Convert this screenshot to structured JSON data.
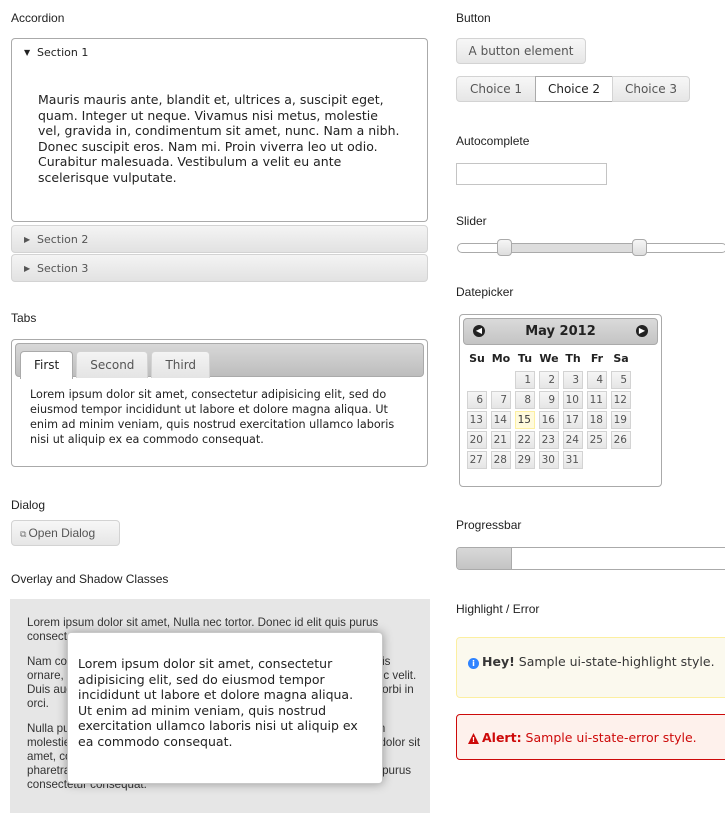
{
  "accordion": {
    "heading": "Accordion",
    "sections": [
      {
        "label": "Section 1",
        "expanded": true
      },
      {
        "label": "Section 2",
        "expanded": false
      },
      {
        "label": "Section 3",
        "expanded": false
      }
    ],
    "content": "Mauris mauris ante, blandit et, ultrices a, suscipit eget, quam. Integer ut neque. Vivamus nisi metus, molestie vel, gravida in, condimentum sit amet, nunc. Nam a nibh. Donec suscipit eros. Nam mi. Proin viverra leo ut odio. Curabitur malesuada. Vestibulum a velit eu ante scelerisque vulputate."
  },
  "tabs": {
    "heading": "Tabs",
    "items": [
      "First",
      "Second",
      "Third"
    ],
    "active_index": 0,
    "content": "Lorem ipsum dolor sit amet, consectetur adipisicing elit, sed do eiusmod tempor incididunt ut labore et dolore magna aliqua. Ut enim ad minim veniam, quis nostrud exercitation ullamco laboris nisi ut aliquip ex ea commodo consequat."
  },
  "dialog": {
    "heading": "Dialog",
    "button_label": "Open Dialog",
    "icon": "newwin-icon"
  },
  "overlay": {
    "heading": "Overlay and Shadow Classes",
    "background_text": [
      "Lorem ipsum dolor sit amet, Nulla nec tortor. Donec id elit quis purus consectetur consequat.",
      "Nam congue semper tellus. Sed erat dolor, dapibus sit amet, venenatis ornare, ultrices ut, nisi. Aliquam ante. Suspendisse scelerisque dui nec velit. Duis augue augue, gravida euismod, vulputate ac, facilisis id, sem. Morbi in orci.",
      "Nulla purus lacus, pulvinar vel, malesuada ac, mattis nec, quam. Nam molestie scelerisque quam. Nullam feugiat cursus lacus.orem ipsum dolor sit amet, consectetur adipiscing elit. Donec libero risus, commodo vitae, pharetra mollis, posuere eu, pede. Nulla nec tortor. Donec id elit quis purus consectetur consequat."
    ],
    "shadow_text": "Lorem ipsum dolor sit amet, consectetur adipisicing elit, sed do eiusmod tempor incididunt ut labore et dolore magna aliqua. Ut enim ad minim veniam, quis nostrud exercitation ullamco laboris nisi ut aliquip ex ea commodo consequat."
  },
  "button": {
    "heading": "Button",
    "single_label": "A button element",
    "choices": [
      "Choice 1",
      "Choice 2",
      "Choice 3"
    ],
    "selected_index": 1
  },
  "autocomplete": {
    "heading": "Autocomplete",
    "value": ""
  },
  "slider": {
    "heading": "Slider",
    "range_start": 17,
    "range_end": 67
  },
  "datepicker": {
    "heading": "Datepicker",
    "title": "May 2012",
    "prev_icon": "circle-triangle-w-icon",
    "next_icon": "circle-triangle-e-icon",
    "weekdays": [
      "Su",
      "Mo",
      "Tu",
      "We",
      "Th",
      "Fr",
      "Sa"
    ],
    "first_weekday_index": 2,
    "days": [
      1,
      2,
      3,
      4,
      5,
      6,
      7,
      8,
      9,
      10,
      11,
      12,
      13,
      14,
      15,
      16,
      17,
      18,
      19,
      20,
      21,
      22,
      23,
      24,
      25,
      26,
      27,
      28,
      29,
      30,
      31
    ],
    "today": 15
  },
  "progressbar": {
    "heading": "Progressbar",
    "value_percent": 20
  },
  "highlight": {
    "heading": "Highlight / Error",
    "highlight_strong": "Hey!",
    "highlight_text": " Sample ui-state-highlight style.",
    "error_strong": "Alert:",
    "error_text": " Sample ui-state-error style.",
    "highlight_icon": "info-icon",
    "error_icon": "alert-icon",
    "highlight_color": "#2e83ff",
    "error_color": "#cd0a0a"
  }
}
